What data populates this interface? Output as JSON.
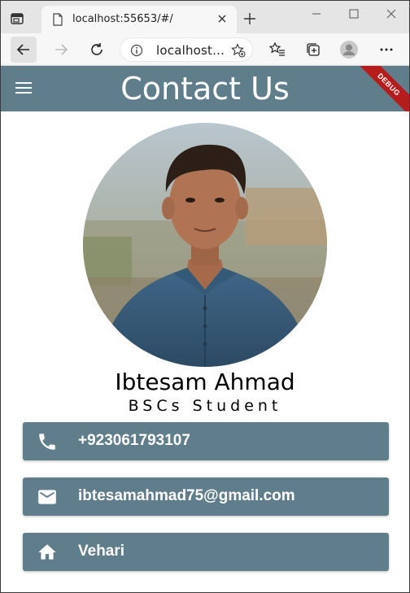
{
  "browser": {
    "tab_title": "localhost:55653/#/",
    "address": "localhost..."
  },
  "app": {
    "title": "Contact Us",
    "debug_banner": "DEBUG",
    "bar_color": "#607d8b"
  },
  "profile": {
    "name": "Ibtesam Ahmad",
    "role": "BSCs Student",
    "photo": "profile-photo"
  },
  "contacts": [
    {
      "icon": "phone-icon",
      "text": "+923061793107"
    },
    {
      "icon": "mail-icon",
      "text": "ibtesamahmad75@gmail.com"
    },
    {
      "icon": "home-icon",
      "text": "Vehari"
    }
  ]
}
